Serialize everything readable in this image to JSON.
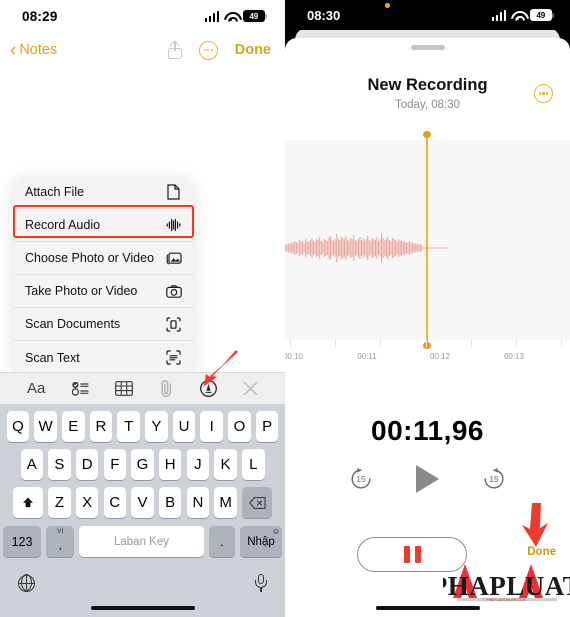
{
  "left_screen": {
    "status_bar": {
      "time": "08:29",
      "battery": "49",
      "icons": [
        "cellular-signal-icon",
        "wifi-icon",
        "battery-icon"
      ]
    },
    "nav_bar": {
      "back_label": "Notes",
      "share_icon": "share-icon",
      "more_icon": "more-circle-icon",
      "done_label": "Done"
    },
    "context_menu": {
      "items": [
        {
          "label": "Attach File",
          "icon": "document-icon"
        },
        {
          "label": "Record Audio",
          "icon": "audio-waveform-icon",
          "highlighted": true
        },
        {
          "label": "Choose Photo or Video",
          "icon": "photo-library-icon"
        },
        {
          "label": "Take Photo or Video",
          "icon": "camera-icon"
        },
        {
          "label": "Scan Documents",
          "icon": "scan-document-icon"
        },
        {
          "label": "Scan Text",
          "icon": "scan-text-icon"
        }
      ],
      "highlight_color": "#EE3B1E"
    },
    "note_toolbar": {
      "items": [
        {
          "label": "Aa",
          "name": "text-format-icon"
        },
        {
          "label": "",
          "name": "checklist-icon"
        },
        {
          "label": "",
          "name": "table-icon"
        },
        {
          "label": "",
          "name": "paperclip-icon"
        },
        {
          "label": "",
          "name": "markup-pen-icon"
        },
        {
          "label": "",
          "name": "close-icon"
        }
      ]
    },
    "keyboard": {
      "row1": [
        "Q",
        "W",
        "E",
        "R",
        "T",
        "Y",
        "U",
        "I",
        "O",
        "P"
      ],
      "row2": [
        "A",
        "S",
        "D",
        "F",
        "G",
        "H",
        "J",
        "K",
        "L"
      ],
      "row3": [
        "Z",
        "X",
        "C",
        "V",
        "B",
        "N",
        "M"
      ],
      "shift_icon": "shift-arrow-icon",
      "backspace_icon": "backspace-icon",
      "numbers_label": "123",
      "vi_sup": "VI",
      "vi_main": ",",
      "space_label": "Laban Key",
      "period_label": ".",
      "return_label": "Nhập",
      "return_emoji": "☺",
      "globe_icon": "globe-icon",
      "dictation_icon": "microphone-icon"
    },
    "annotation": {
      "arrow_color": "#ED3B2C",
      "arrow_name": "red-arrow-to-paperclip"
    }
  },
  "right_screen": {
    "status_bar": {
      "time": "08:30",
      "battery": "49",
      "recording_dot": "orange-recording-indicator"
    },
    "sheet": {
      "grabber": "sheet-grabber",
      "title": "New Recording",
      "subtitle": "Today, 08:30",
      "more_icon": "more-circle-icon"
    },
    "waveform": {
      "playhead_color": "#E8B838",
      "wave_color": "#E79A8E",
      "background": "#F7F7F7",
      "tick_labels": [
        "00:10",
        "00:11",
        "00:12",
        "00:13"
      ],
      "playhead_time": "00:11,96"
    },
    "timer": "00:11,96",
    "transport": {
      "rewind_label": "15",
      "forward_label": "15",
      "rewind_icon": "skip-back-15-icon",
      "play_icon": "play-icon",
      "forward_icon": "skip-forward-15-icon"
    },
    "pause_button": {
      "name": "pause-button",
      "color": "#ED3B2C"
    },
    "done_label": "Done",
    "annotation": {
      "arrow_color": "#ED3B2C",
      "arrow_name": "red-arrow-to-done"
    },
    "watermark": {
      "text": "PHAPLUAT",
      "accent_color": "#ED1C24"
    }
  }
}
